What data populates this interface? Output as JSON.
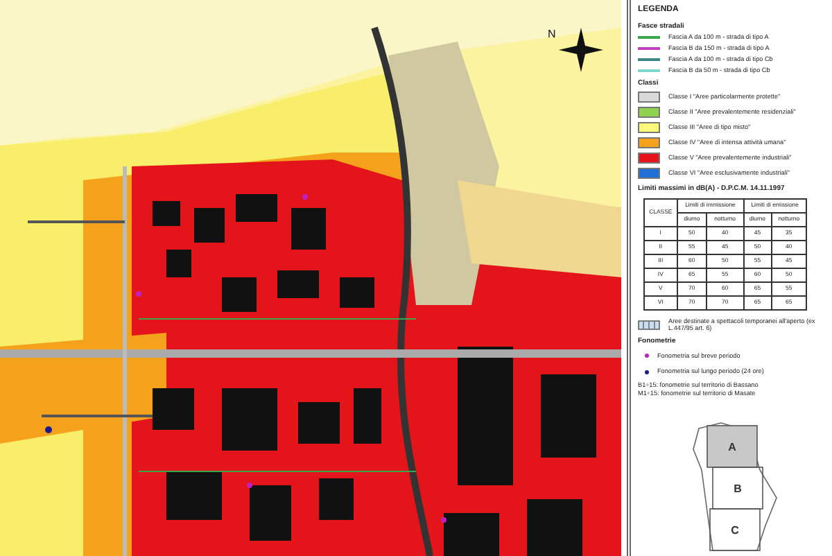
{
  "map": {
    "compass_label": "N"
  },
  "legend": {
    "title": "LEGENDA",
    "road_heading": "Fasce stradali",
    "roads": [
      {
        "label": "Fascia A da 100 m - strada di tipo A",
        "color": "#3aa84a"
      },
      {
        "label": "Fascia B da 150 m - strada di tipo A",
        "color": "#c040c0"
      },
      {
        "label": "Fascia A da 100 m - strada di tipo Cb",
        "color": "#3a8a8a"
      },
      {
        "label": "Fascia B da 50 m - strada di tipo Cb",
        "color": "#7fd8d0"
      }
    ],
    "class_heading": "Classi",
    "classes": [
      {
        "label": "Classe I \"Aree particolarmente protette\"",
        "color": "#d9d9d9"
      },
      {
        "label": "Classe II \"Aree prevalentemente residenziali\"",
        "color": "#8fd14f"
      },
      {
        "label": "Classe III \"Aree di tipo misto\"",
        "color": "#fbf77a"
      },
      {
        "label": "Classe IV \"Aree di intensa attività umana\"",
        "color": "#f4a21c"
      },
      {
        "label": "Classe V \"Aree prevalentemente industriali\"",
        "color": "#e3141a"
      },
      {
        "label": "Classe VI \"Aree esclusivamente industriali\"",
        "color": "#1f6fd6"
      }
    ],
    "limits_title": "Limiti massimi in dB(A) - D.P.C.M. 14.11.1997",
    "table": {
      "header_rows": [
        [
          {
            "label": "CLASSE",
            "rowspan": 2
          },
          {
            "label": "Limiti di immissione",
            "colspan": 2
          },
          {
            "label": "Limiti di emissione",
            "colspan": 2
          }
        ],
        [
          {
            "label": "diurno"
          },
          {
            "label": "notturno"
          },
          {
            "label": "diurno"
          },
          {
            "label": "notturno"
          }
        ]
      ],
      "rows": [
        [
          "I",
          "50",
          "40",
          "45",
          "35"
        ],
        [
          "II",
          "55",
          "45",
          "50",
          "40"
        ],
        [
          "III",
          "60",
          "50",
          "55",
          "45"
        ],
        [
          "IV",
          "65",
          "55",
          "60",
          "50"
        ],
        [
          "V",
          "70",
          "60",
          "65",
          "55"
        ],
        [
          "VI",
          "70",
          "70",
          "65",
          "65"
        ]
      ]
    },
    "temporary_area": "Aree destinate a spettacoli temporanei all'aperto (ex L.447/95 art. 6)",
    "measure_heading": "Fonometrie",
    "measures": [
      {
        "label": "Fonometria sul breve periodo",
        "color": "#c020c0"
      },
      {
        "label": "Fonometria sul lungo periodo (24 ore)",
        "color": "#1a1a8a"
      }
    ],
    "notes": [
      "B1÷15: fonometrie sul territorio di Bassano",
      "M1÷15: fonometrie sul territorio di Masate"
    ],
    "key_map": {
      "sheets": [
        {
          "label": "A",
          "selected": true
        },
        {
          "label": "B",
          "selected": false
        },
        {
          "label": "C",
          "selected": false
        }
      ]
    }
  }
}
